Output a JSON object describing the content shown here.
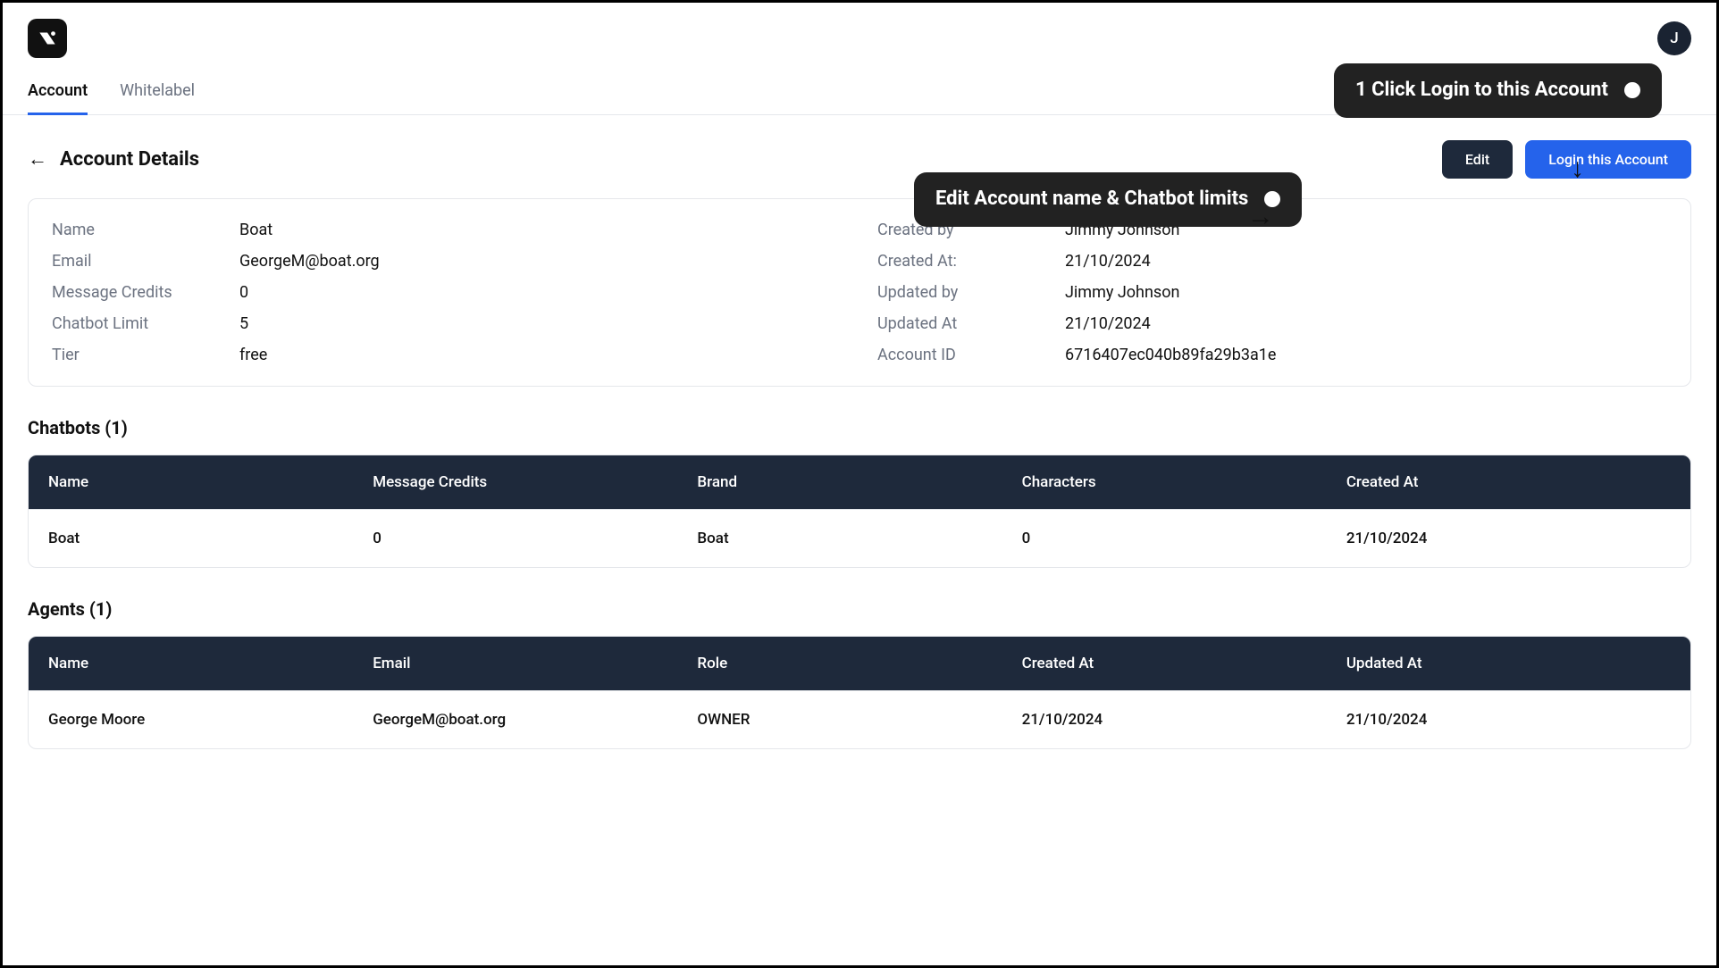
{
  "avatar_initial": "J",
  "tabs": {
    "account": "Account",
    "whitelabel": "Whitelabel"
  },
  "page_title": "Account Details",
  "buttons": {
    "edit": "Edit",
    "login": "Login this Account"
  },
  "details": {
    "left": [
      {
        "label": "Name",
        "value": "Boat"
      },
      {
        "label": "Email",
        "value": "GeorgeM@boat.org"
      },
      {
        "label": "Message Credits",
        "value": "0"
      },
      {
        "label": "Chatbot Limit",
        "value": "5"
      },
      {
        "label": "Tier",
        "value": "free"
      }
    ],
    "right": [
      {
        "label": "Created by",
        "value": "Jimmy Johnson"
      },
      {
        "label": "Created At:",
        "value": "21/10/2024"
      },
      {
        "label": "Updated by",
        "value": "Jimmy Johnson"
      },
      {
        "label": "Updated At",
        "value": "21/10/2024"
      },
      {
        "label": "Account ID",
        "value": "6716407ec040b89fa29b3a1e"
      }
    ]
  },
  "chatbots": {
    "title": "Chatbots (1)",
    "headers": [
      "Name",
      "Message Credits",
      "Brand",
      "Characters",
      "Created At"
    ],
    "rows": [
      [
        "Boat",
        "0",
        "Boat",
        "0",
        "21/10/2024"
      ]
    ]
  },
  "agents": {
    "title": "Agents (1)",
    "headers": [
      "Name",
      "Email",
      "Role",
      "Created At",
      "Updated At"
    ],
    "rows": [
      [
        "George Moore",
        "GeorgeM@boat.org",
        "OWNER",
        "21/10/2024",
        "21/10/2024"
      ]
    ]
  },
  "callouts": {
    "edit": "Edit Account name & Chatbot limits",
    "login": "1 Click Login to this Account"
  }
}
